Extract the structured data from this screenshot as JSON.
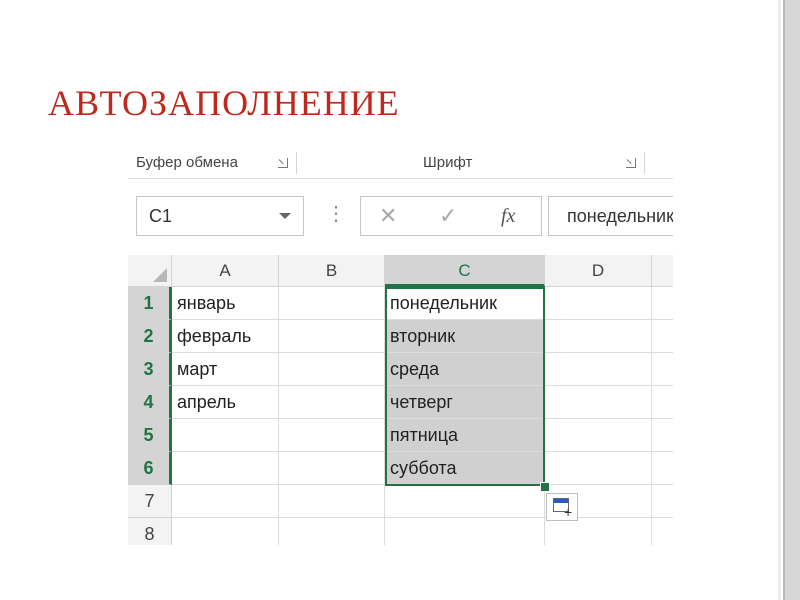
{
  "slide": {
    "title": "АВТОЗАПОЛНЕНИЕ"
  },
  "ribbon": {
    "clipboard_label": "Буфер обмена",
    "font_label": "Шрифт"
  },
  "formula_bar": {
    "name_box": "C1",
    "cancel_glyph": "✕",
    "enter_glyph": "✓",
    "fx_glyph": "fx",
    "formula_value": "понедельник",
    "dots_glyph": "⋮"
  },
  "grid": {
    "columns": [
      "A",
      "B",
      "C",
      "D"
    ],
    "rows": [
      "1",
      "2",
      "3",
      "4",
      "5",
      "6",
      "7",
      "8"
    ],
    "col_a": [
      "январь",
      "февраль",
      "март",
      "апрель"
    ],
    "col_c": [
      "понедельник",
      "вторник",
      "среда",
      "четверг",
      "пятница",
      "суббота"
    ],
    "selected_column": "C"
  },
  "colors": {
    "title": "#c0281e",
    "excel_accent": "#217346",
    "selection_fill": "#d0d0d0"
  },
  "icons": [
    "dialog-launcher-icon",
    "cancel-icon",
    "enter-icon",
    "function-icon",
    "dropdown-icon",
    "autofill-options-icon",
    "select-all-icon"
  ]
}
